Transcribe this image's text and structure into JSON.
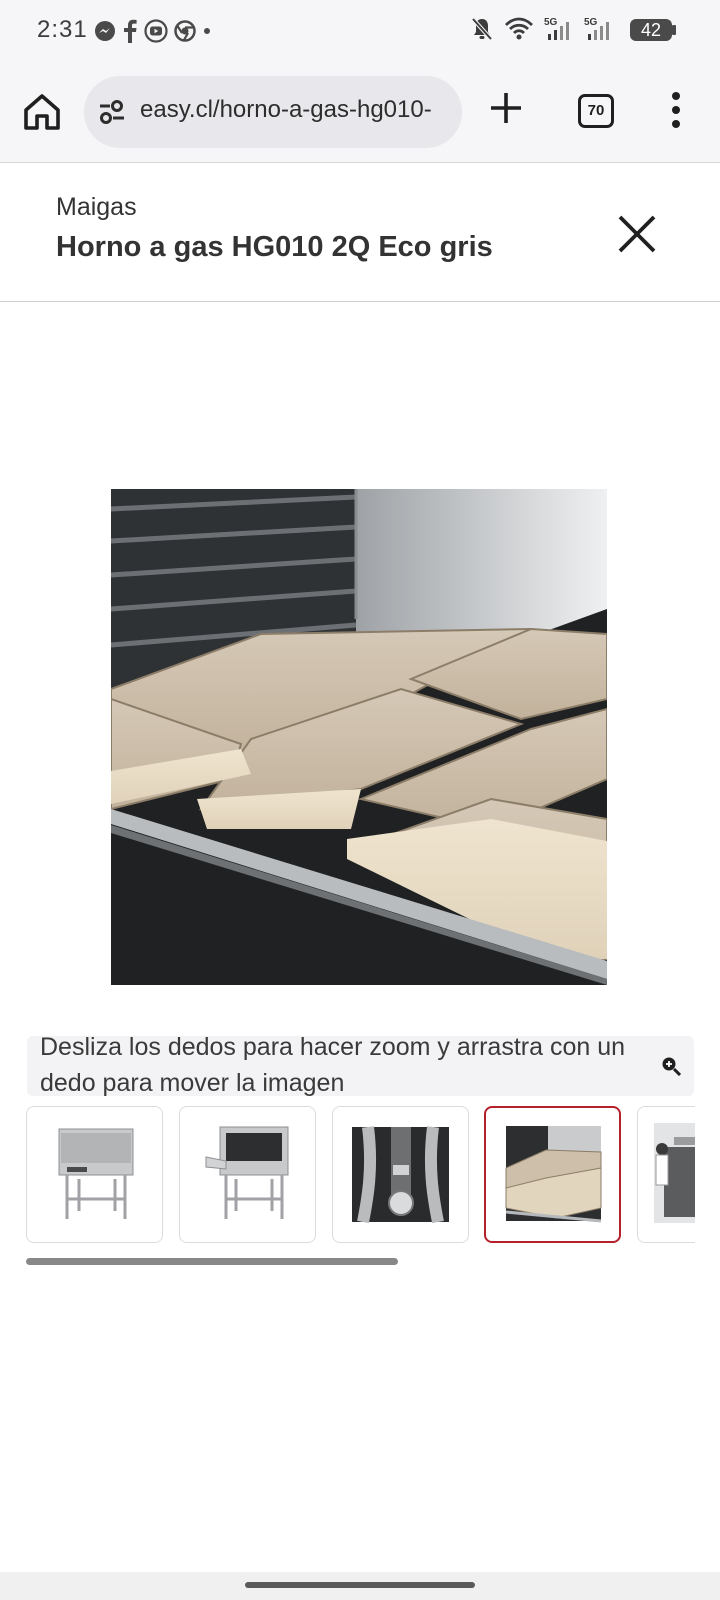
{
  "status_bar": {
    "time": "2:31",
    "notification_icons": [
      "messenger-icon",
      "facebook-icon",
      "youtube-icon",
      "chrome-icon",
      "dot-icon"
    ],
    "system_icons": [
      "mute-icon",
      "wifi-icon",
      "signal-5g-icon",
      "signal-5g-icon"
    ],
    "battery": "42"
  },
  "browser": {
    "url": "easy.cl/horno-a-gas-hg010-",
    "tab_count": "70"
  },
  "product": {
    "brand": "Maigas",
    "title": "Horno a gas HG010 2Q Eco gris"
  },
  "gallery": {
    "hint": "Desliza los dedos para hacer zoom y arrastra con un dedo para mover la imagen",
    "selected_index": 3,
    "thumbnail_count_visible": 5
  },
  "colors": {
    "accent_selected": "#b5212b",
    "toolbar_bg": "#f6f6f8"
  }
}
